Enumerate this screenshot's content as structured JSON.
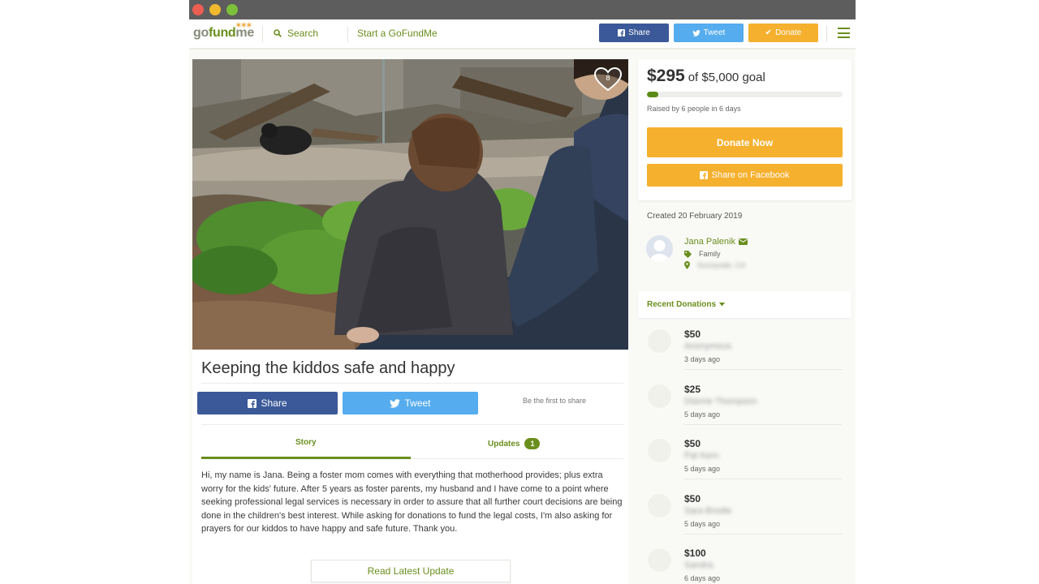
{
  "nav": {
    "logo_go": "go",
    "logo_fund": "fund",
    "logo_me": "me",
    "search_label": "Search",
    "start_label": "Start a GoFundMe",
    "share_label": "Share",
    "tweet_label": "Tweet",
    "donate_label": "Donate"
  },
  "campaign": {
    "title": "Keeping the kiddos safe and happy",
    "heart_count": "8",
    "share_label": "Share",
    "tweet_label": "Tweet",
    "first_share_text": "Be the first to share",
    "tabs": {
      "story_label": "Story",
      "updates_label": "Updates",
      "updates_count": "1"
    },
    "story_text": "Hi, my name is Jana. Being a foster mom comes with everything that motherhood provides; plus extra worry for the kids' future. After 5 years as foster parents, my husband and I  have come to a point where seeking professional legal services is necessary in order to assure that all further court decisions are being done in the children's best interest. While asking for donations to fund the legal costs, I'm also asking for prayers for our kiddos to have happy and safe future. Thank you.",
    "read_update_label": "Read Latest Update"
  },
  "goal": {
    "raised_amount": "$295",
    "goal_text": "of $5,000 goal",
    "progress_fraction": 0.059,
    "raised_by_text": "Raised by 6 people in 6 days",
    "donate_now_label": "Donate Now",
    "share_facebook_label": "Share on Facebook"
  },
  "organizer": {
    "created_text": "Created 20 February 2019",
    "name": "Jana Palenik",
    "category": "Family",
    "location": "Sunnyvale, CA"
  },
  "recent": {
    "label": "Recent Donations",
    "donations": [
      {
        "amount": "$50",
        "name": "Anonymous",
        "when": "3 days ago"
      },
      {
        "amount": "$25",
        "name": "Dianne Thompson",
        "when": "5 days ago"
      },
      {
        "amount": "$50",
        "name": "Pat Kern",
        "when": "5 days ago"
      },
      {
        "amount": "$50",
        "name": "Sara Brodie",
        "when": "5 days ago"
      },
      {
        "amount": "$100",
        "name": "Sandra",
        "when": "6 days ago"
      }
    ]
  },
  "colors": {
    "brand_green": "#6a8e1d",
    "donate_orange": "#f5b02e",
    "facebook_blue": "#3b5998",
    "twitter_blue": "#55acee"
  }
}
